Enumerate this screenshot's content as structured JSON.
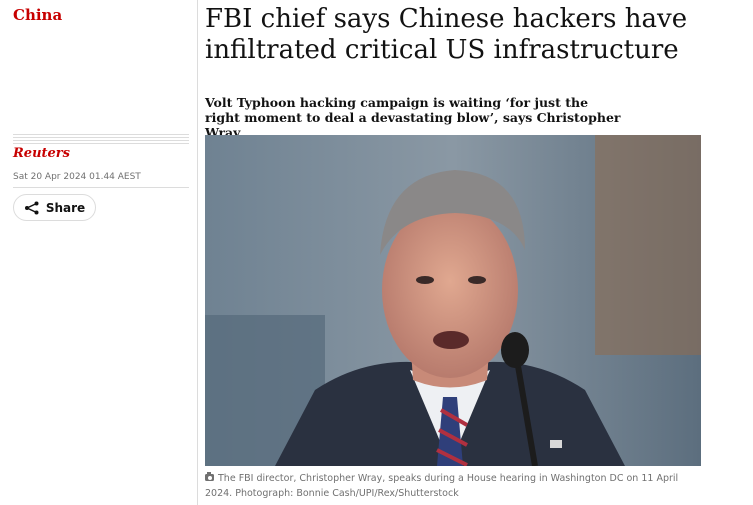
{
  "section": {
    "label": "China",
    "color": "#c70000"
  },
  "byline": {
    "author": "Reuters",
    "date": "Sat 20 Apr 2024 01.44 AEST"
  },
  "share": {
    "label": "Share",
    "icon": "share-icon"
  },
  "article": {
    "headline": "FBI chief says Chinese hackers have infiltrated critical US infrastructure",
    "standfirst": "Volt Typhoon hacking campaign is waiting ‘for just the right moment to deal a devastating blow’, says Christopher Wray",
    "image_caption": "The FBI director, Christopher Wray, speaks during a House hearing in Washington DC on 11 April 2024. Photograph: Bonnie Cash/UPI/Rex/Shutterstock",
    "caption_icon": "camera-icon"
  },
  "colors": {
    "accent": "#c70000",
    "text": "#121212",
    "muted": "#707070",
    "rule": "#dcdcdc"
  }
}
